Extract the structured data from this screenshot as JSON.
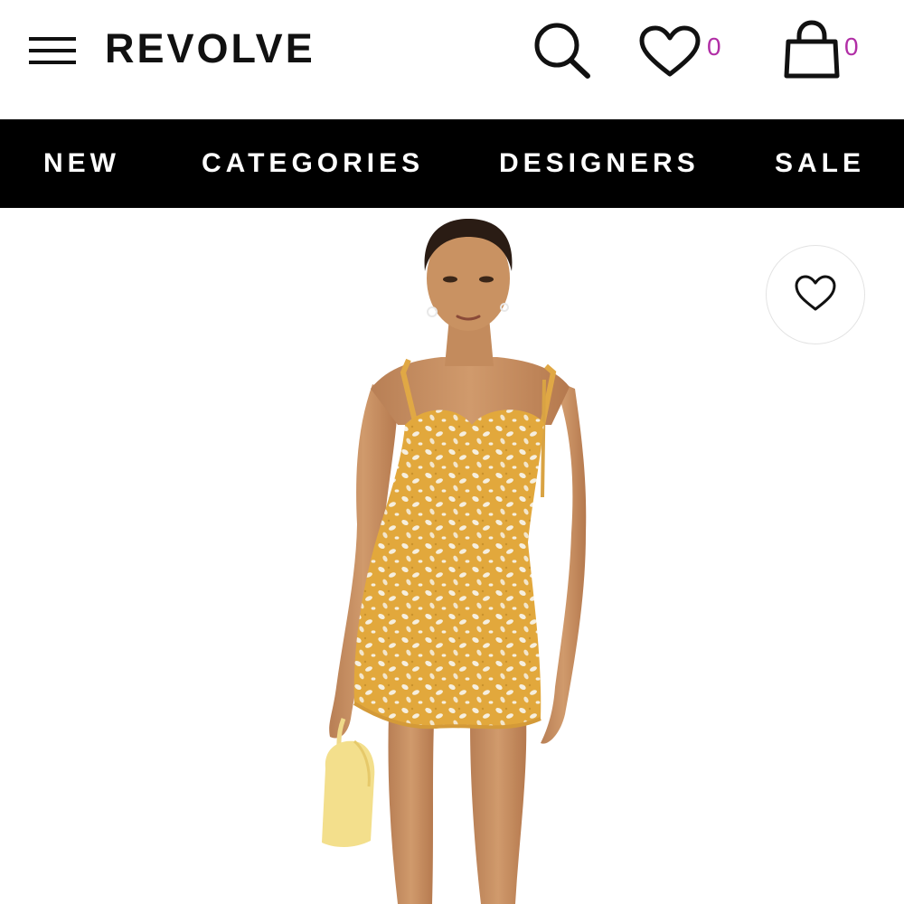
{
  "header": {
    "logo": "REVOLVE",
    "menu_icon": "hamburger-menu-icon",
    "search_icon": "search-icon",
    "wishlist_icon": "heart-icon",
    "wishlist_count": "0",
    "bag_icon": "shopping-bag-icon",
    "bag_count": "0",
    "badge_color": "#b12ea6"
  },
  "nav": {
    "items": [
      {
        "label": "NEW"
      },
      {
        "label": "CATEGORIES"
      },
      {
        "label": "DESIGNERS"
      },
      {
        "label": "SALE"
      }
    ],
    "background": "#000000",
    "text_color": "#ffffff"
  },
  "product": {
    "image_alt": "Model wearing yellow floral mini dress with tie straps, holding a yellow handbag",
    "favorite_icon": "heart-outline-icon",
    "dress_color": "#e2a83c"
  }
}
